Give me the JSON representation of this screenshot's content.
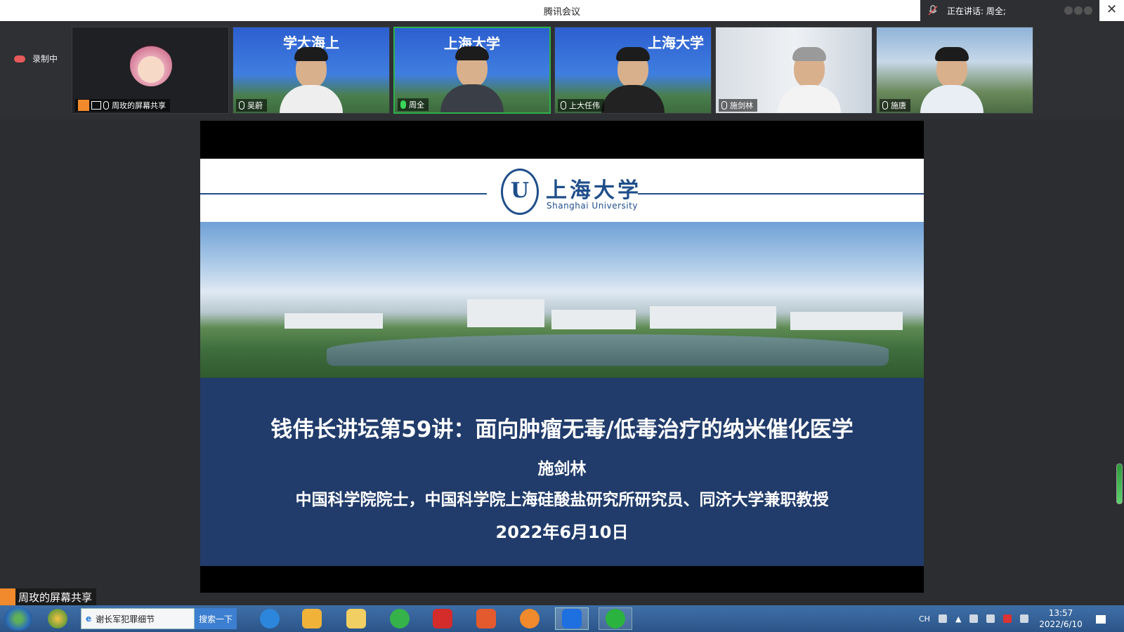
{
  "window": {
    "title": "腾讯会议",
    "speaking_label": "正在讲话: 周全;",
    "close_icon": "close-icon"
  },
  "recording": {
    "label": "录制中",
    "icon": "cloud-record-icon"
  },
  "participants": [
    {
      "name": "周玫的屏幕共享",
      "video": "avatar",
      "mic": "off"
    },
    {
      "name": "吴蔚",
      "video": "camera",
      "mic": "off",
      "backdrop_text": "学大海上"
    },
    {
      "name": "周全",
      "video": "camera",
      "mic": "on",
      "active": true,
      "backdrop_text": "上海大学"
    },
    {
      "name": "上大任伟",
      "video": "camera",
      "mic": "off",
      "backdrop_text": "上海大学"
    },
    {
      "name": "施剑林",
      "video": "camera",
      "mic": "off"
    },
    {
      "name": "施唐",
      "video": "camera",
      "mic": "off"
    }
  ],
  "slide": {
    "university_cn": "上海大学",
    "university_en": "Shanghai University",
    "title": "钱伟长讲坛第59讲：面向肿瘤无毒/低毒治疗的纳米催化医学",
    "speaker": "施剑林",
    "affiliation": "中国科学院院士，中国科学院上海硅酸盐研究所研究员、同济大学兼职教授",
    "date": "2022年6月10日",
    "colors": {
      "banner": "#213c6b",
      "line": "#1f4e8a"
    }
  },
  "share_label": "周玫的屏幕共享",
  "taskbar": {
    "search_value": "谢长军犯罪细节",
    "search_button": "搜索一下",
    "apps": [
      "ie-icon",
      "media-player-icon",
      "file-explorer-icon",
      "browser-360-icon",
      "youdao-icon",
      "powerpoint-icon",
      "sogou-icon",
      "tencent-meeting-icon",
      "wechat-icon"
    ],
    "tray_lang": "CH",
    "time": "13:57",
    "date": "2022/6/10"
  }
}
